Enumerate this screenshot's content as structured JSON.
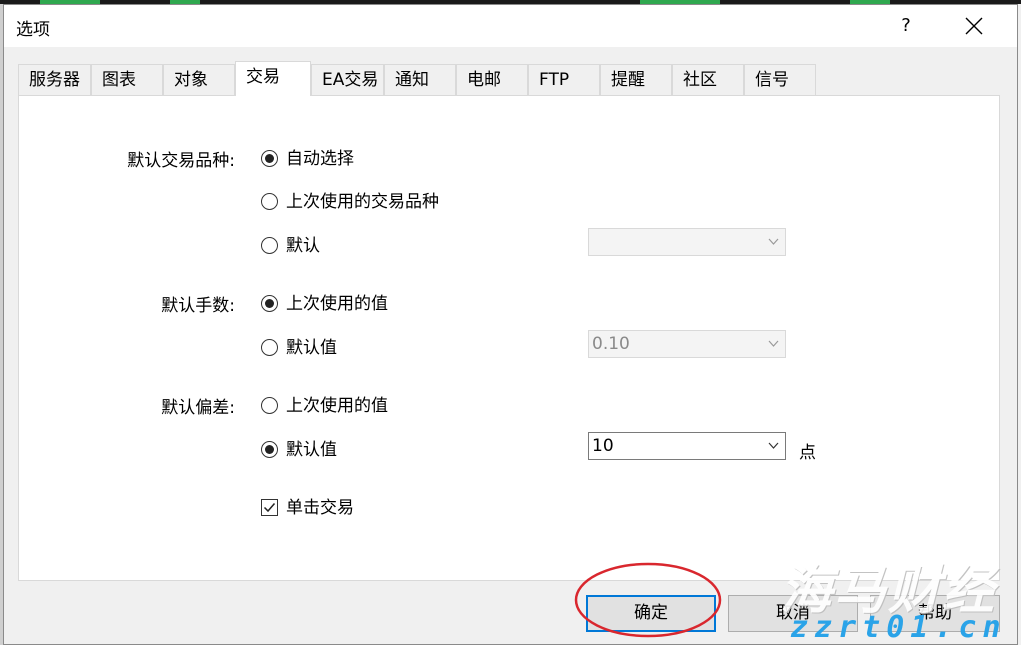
{
  "window": {
    "title": "选项",
    "help_glyph": "?"
  },
  "tabs": [
    {
      "label": "服务器",
      "active": false
    },
    {
      "label": "图表",
      "active": false
    },
    {
      "label": "对象",
      "active": false
    },
    {
      "label": "交易",
      "active": true
    },
    {
      "label": "EA交易",
      "active": false
    },
    {
      "label": "通知",
      "active": false
    },
    {
      "label": "电邮",
      "active": false
    },
    {
      "label": "FTP",
      "active": false
    },
    {
      "label": "提醒",
      "active": false
    },
    {
      "label": "社区",
      "active": false
    },
    {
      "label": "信号",
      "active": false
    }
  ],
  "symbol_group": {
    "label": "默认交易品种:",
    "options": [
      {
        "label": "自动选择",
        "checked": true
      },
      {
        "label": "上次使用的交易品种",
        "checked": false
      },
      {
        "label": "默认",
        "checked": false
      }
    ],
    "combo_value": ""
  },
  "lots_group": {
    "label": "默认手数:",
    "options": [
      {
        "label": "上次使用的值",
        "checked": true
      },
      {
        "label": "默认值",
        "checked": false
      }
    ],
    "combo_value": "0.10"
  },
  "deviation_group": {
    "label": "默认偏差:",
    "options": [
      {
        "label": "上次使用的值",
        "checked": false
      },
      {
        "label": "默认值",
        "checked": true
      }
    ],
    "combo_value": "10",
    "unit": "点"
  },
  "one_click": {
    "label": "单击交易",
    "checked": true
  },
  "buttons": {
    "ok": "确定",
    "cancel": "取消",
    "help": "帮助"
  },
  "watermark": {
    "title": "海马财经",
    "url": "zzrt01.cn"
  },
  "colors": {
    "accent": "#0078d7",
    "annotation": "#d9272e",
    "watermark_url": "#2aa3e8"
  }
}
